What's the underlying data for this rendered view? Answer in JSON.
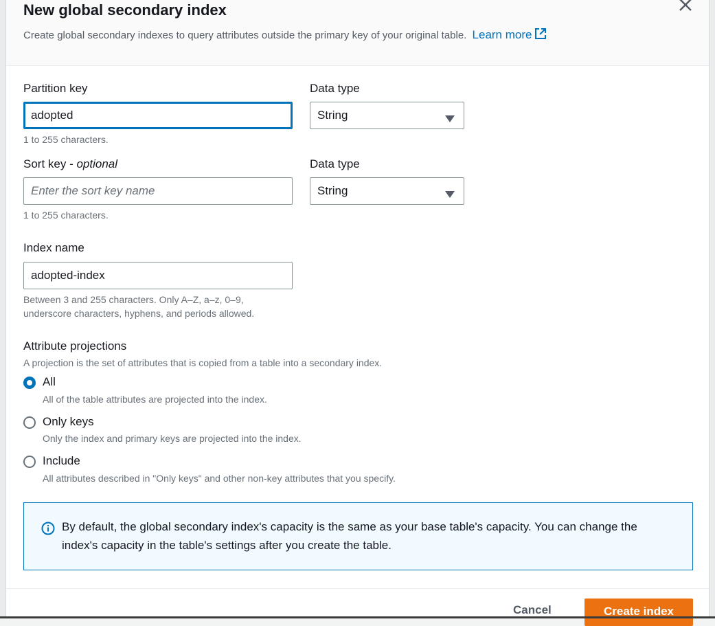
{
  "modal": {
    "title": "New global secondary index",
    "description": "Create global secondary indexes to query attributes outside the primary key of your original table.",
    "learn_more": "Learn more",
    "icons": {
      "close": "close-icon",
      "external_link": "external-link-icon"
    }
  },
  "partition_key": {
    "label": "Partition key",
    "value": "adopted",
    "hint": "1 to 255 characters.",
    "data_type_label": "Data type",
    "data_type": "String"
  },
  "sort_key": {
    "label": "Sort key - ",
    "label_optional": "optional",
    "placeholder": "Enter the sort key name",
    "value": "",
    "hint": "1 to 255 characters.",
    "data_type_label": "Data type",
    "data_type": "String"
  },
  "index_name": {
    "label": "Index name",
    "value": "adopted-index",
    "hint_line1": "Between 3 and 255 characters. Only A–Z, a–z, 0–9,",
    "hint_line2": "underscore characters, hyphens, and periods allowed."
  },
  "projections": {
    "label": "Attribute projections",
    "description": "A projection is the set of attributes that is copied from a table into a secondary index.",
    "selected": "All",
    "options": [
      {
        "label": "All",
        "description": "All of the table attributes are projected into the index."
      },
      {
        "label": "Only keys",
        "description": "Only the index and primary keys are projected into the index."
      },
      {
        "label": "Include",
        "description": "All attributes described in \"Only keys\" and other non-key attributes that you specify."
      }
    ]
  },
  "info": {
    "icon": "info-icon",
    "text": "By default, the global secondary index's capacity is the same as your base table's capacity. You can change the index's capacity in the table's settings after you create the table."
  },
  "footer": {
    "cancel": "Cancel",
    "create": "Create index"
  },
  "colors": {
    "accent": "#0073bb",
    "primary_button": "#ec7211",
    "info_bg": "#f1faff"
  }
}
